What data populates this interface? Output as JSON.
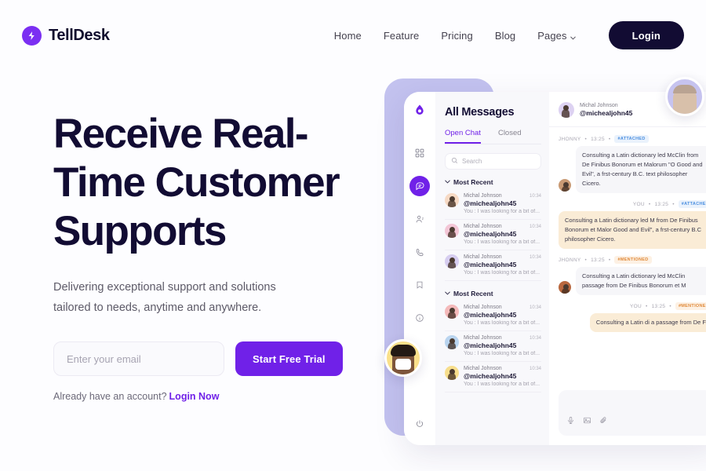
{
  "brand": {
    "name": "TellDesk",
    "mark_icon": "lightning-bolt-icon",
    "mark_color": "#7b2ff2"
  },
  "nav": {
    "links": [
      {
        "label": "Home"
      },
      {
        "label": "Feature"
      },
      {
        "label": "Pricing"
      },
      {
        "label": "Blog"
      },
      {
        "label": "Pages",
        "has_chevron": true
      }
    ],
    "login_label": "Login"
  },
  "hero": {
    "title_line1": "Receive Real-",
    "title_line2": "Time Customer",
    "title_line3": "Supports",
    "highlight_color": "#eec98a",
    "subtitle_line1": "Delivering exceptional support and solutions",
    "subtitle_line2": "tailored to needs, anytime and anywhere.",
    "email_placeholder": "Enter your email",
    "email_value": "",
    "cta_label": "Start Free Trial",
    "cta_color": "#7021e8",
    "account_text": "Already have an account?",
    "account_link": "Login Now"
  },
  "mockup": {
    "sidebar": {
      "logo_icon": "droplet-logo-icon",
      "items": [
        {
          "icon": "grid-dashboard-icon",
          "active": false
        },
        {
          "icon": "chat-bubble-icon",
          "active": true
        },
        {
          "icon": "contacts-icon",
          "active": false
        },
        {
          "icon": "phone-icon",
          "active": false
        },
        {
          "icon": "bookmark-icon",
          "active": false
        },
        {
          "icon": "info-icon",
          "active": false
        }
      ],
      "power_icon": "power-icon"
    },
    "list": {
      "title": "All Messages",
      "tabs": [
        {
          "label": "Open Chat",
          "active": true
        },
        {
          "label": "Closed",
          "active": false
        }
      ],
      "search_placeholder": "Search",
      "search_icon": "search-icon",
      "groups": [
        {
          "label": "Most Recent",
          "items": [
            {
              "name": "Michal Johnson",
              "time": "10:34",
              "handle": "@michealjohn45",
              "preview": "You : I was looking for a bit of...",
              "avatar_color": "#f6d9c4"
            },
            {
              "name": "Michal Johnson",
              "time": "10:34",
              "handle": "@michealjohn45",
              "preview": "You : I was looking for a bit of...",
              "avatar_color": "#f3c6d6"
            },
            {
              "name": "Michal Johnson",
              "time": "10:34",
              "handle": "@michealjohn45",
              "preview": "You : I was looking for a bit of...",
              "avatar_color": "#d6cdf0"
            }
          ]
        },
        {
          "label": "Most Recent",
          "items": [
            {
              "name": "Michal Johnson",
              "time": "10:34",
              "handle": "@michealjohn45",
              "preview": "You : I was looking for a bit of...",
              "avatar_color": "#f4b9ba"
            },
            {
              "name": "Michal Johnson",
              "time": "10:34",
              "handle": "@michealjohn45",
              "preview": "You : I was looking for a bit of...",
              "avatar_color": "#b9d4ef"
            },
            {
              "name": "Michal Johnson",
              "time": "10:34",
              "handle": "@michealjohn45",
              "preview": "You : I was looking for a bit of...",
              "avatar_color": "#f7de8c"
            }
          ]
        }
      ]
    },
    "chat": {
      "header": {
        "name": "Michal Johnson",
        "handle": "@michealjohn45",
        "avatar_color": "#ddd2f2"
      },
      "messages": [
        {
          "sender": "JHONNY",
          "time": "13:25",
          "tag": "#ATTACHED",
          "tag_type": "attached",
          "direction": "in",
          "bubble": "grey",
          "text": "Consulting a Latin dictionary led McClin from De Finibus Bonorum et Malorum \"O Good and Evil\", a frst-century B.C. text philosopher Cicero.",
          "avatar_color": "#c99a74"
        },
        {
          "sender": "YOU",
          "time": "13:25",
          "tag": "#ATTACHED",
          "tag_type": "attached",
          "direction": "out",
          "bubble": "cream",
          "text": "Consulting a Latin dictionary led M from De Finibus Bonorum et Malor Good and Evil\", a frst-century B.C philosopher Cicero."
        },
        {
          "sender": "JHONNY",
          "time": "13:25",
          "tag": "#MENTIONED",
          "tag_type": "mentioned",
          "direction": "in",
          "bubble": "grey",
          "text": "Consulting a Latin dictionary led McClin passage from De Finibus Bonorum et M",
          "avatar_color": "#b9683f"
        },
        {
          "sender": "YOU",
          "time": "13:25",
          "tag": "#MENTIONED",
          "tag_type": "mentioned",
          "direction": "out",
          "bubble": "cream",
          "text": "Consulting a Latin di a passage from De F"
        }
      ],
      "compose_icons": [
        {
          "icon": "microphone-icon"
        },
        {
          "icon": "image-icon"
        },
        {
          "icon": "paperclip-icon"
        }
      ]
    },
    "floating_avatars": [
      {
        "position": "top-right",
        "background": "#c6c3ef"
      },
      {
        "position": "left",
        "background": "#fae08a"
      }
    ]
  }
}
